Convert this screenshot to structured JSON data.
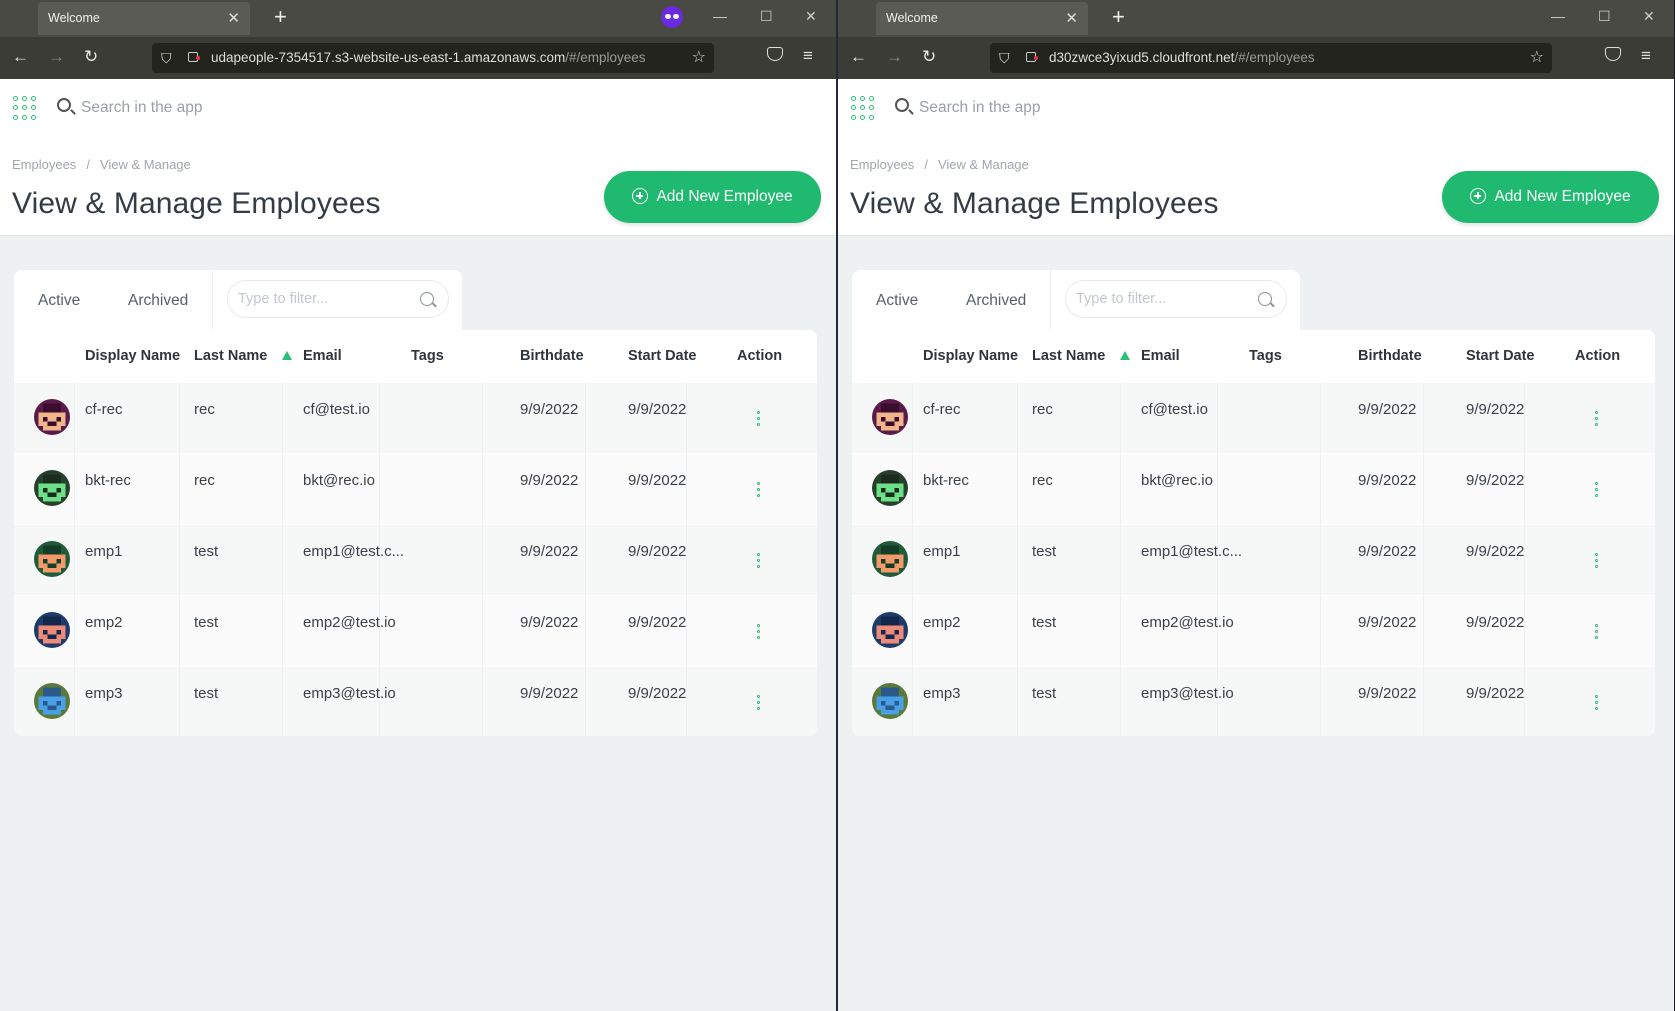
{
  "windows": [
    {
      "side": "left",
      "tab_title": "Welcome",
      "url_host": "udapeople-7354517.s3-website-us-east-1.amazonaws.com",
      "url_path": "/#/employees",
      "private_icon": "private-browsing-mask-icon"
    },
    {
      "side": "right",
      "tab_title": "Welcome",
      "url_host": "d30zwce3yixud5.cloudfront.net",
      "url_path": "/#/employees"
    }
  ],
  "app": {
    "search_placeholder": "Search in the app",
    "breadcrumb": [
      "Employees",
      "/",
      "View & Manage"
    ],
    "page_title": "View & Manage Employees",
    "add_button_label": "Add New Employee",
    "tabs": [
      "Active",
      "Archived"
    ],
    "filter_placeholder": "Type to filter...",
    "columns": [
      "Display Name",
      "Last Name",
      "Email",
      "Tags",
      "Birthdate",
      "Start Date",
      "Action"
    ],
    "sorted_column": "Last Name",
    "sort_direction": "ascending",
    "accent_color": "#1fb970",
    "rows": [
      {
        "display_name": "cf-rec",
        "last_name": "rec",
        "email": "cf@test.io",
        "tags": "",
        "birthdate": "9/9/2022",
        "start_date": "9/9/2022",
        "avatar": "pixel-avatar-purple"
      },
      {
        "display_name": "bkt-rec",
        "last_name": "rec",
        "email": "bkt@rec.io",
        "tags": "",
        "birthdate": "9/9/2022",
        "start_date": "9/9/2022",
        "avatar": "pixel-avatar-green"
      },
      {
        "display_name": "emp1",
        "last_name": "test",
        "email": "emp1@test.c...",
        "tags": "",
        "birthdate": "9/9/2022",
        "start_date": "9/9/2022",
        "avatar": "pixel-avatar-darkgreen"
      },
      {
        "display_name": "emp2",
        "last_name": "test",
        "email": "emp2@test.io",
        "tags": "",
        "birthdate": "9/9/2022",
        "start_date": "9/9/2022",
        "avatar": "pixel-avatar-navy"
      },
      {
        "display_name": "emp3",
        "last_name": "test",
        "email": "emp3@test.io",
        "tags": "",
        "birthdate": "9/9/2022",
        "start_date": "9/9/2022",
        "avatar": "pixel-avatar-blue"
      }
    ]
  }
}
